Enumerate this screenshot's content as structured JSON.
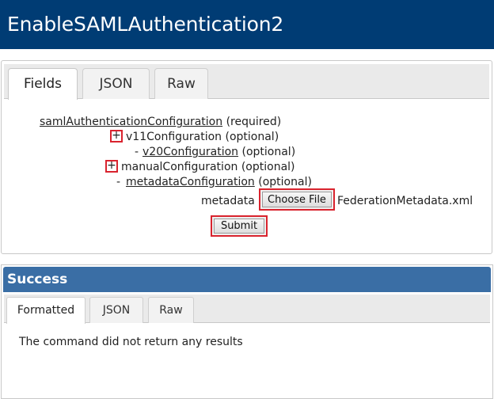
{
  "header": {
    "title": "EnableSAMLAuthentication2"
  },
  "fields_panel": {
    "tabs": [
      {
        "label": "Fields",
        "active": true
      },
      {
        "label": "JSON",
        "active": false
      },
      {
        "label": "Raw",
        "active": false
      }
    ],
    "tree": {
      "root": {
        "link": "samlAuthenticationConfiguration",
        "suffix": "(required)"
      },
      "v11": {
        "expander": "+",
        "name": "v11Configuration",
        "suffix": "(optional)"
      },
      "v20": {
        "dash": "-",
        "link": "v20Configuration",
        "suffix": "(optional)"
      },
      "manual": {
        "expander": "+",
        "name": "manualConfiguration",
        "suffix": "(optional)"
      },
      "metadata_config": {
        "dash": "-",
        "link": "metadataConfiguration",
        "suffix": "(optional)"
      }
    },
    "metadata": {
      "label": "metadata",
      "choose_file_label": "Choose File",
      "file_name": "FederationMetadata.xml"
    },
    "submit_label": "Submit"
  },
  "success_panel": {
    "title": "Success",
    "tabs": [
      {
        "label": "Formatted",
        "active": true
      },
      {
        "label": "JSON",
        "active": false
      },
      {
        "label": "Raw",
        "active": false
      }
    ],
    "message": "The command did not return any results"
  },
  "colors": {
    "header_bg": "#003c74",
    "success_bg": "#3a6ea5",
    "highlight_red": "#d9232e"
  }
}
